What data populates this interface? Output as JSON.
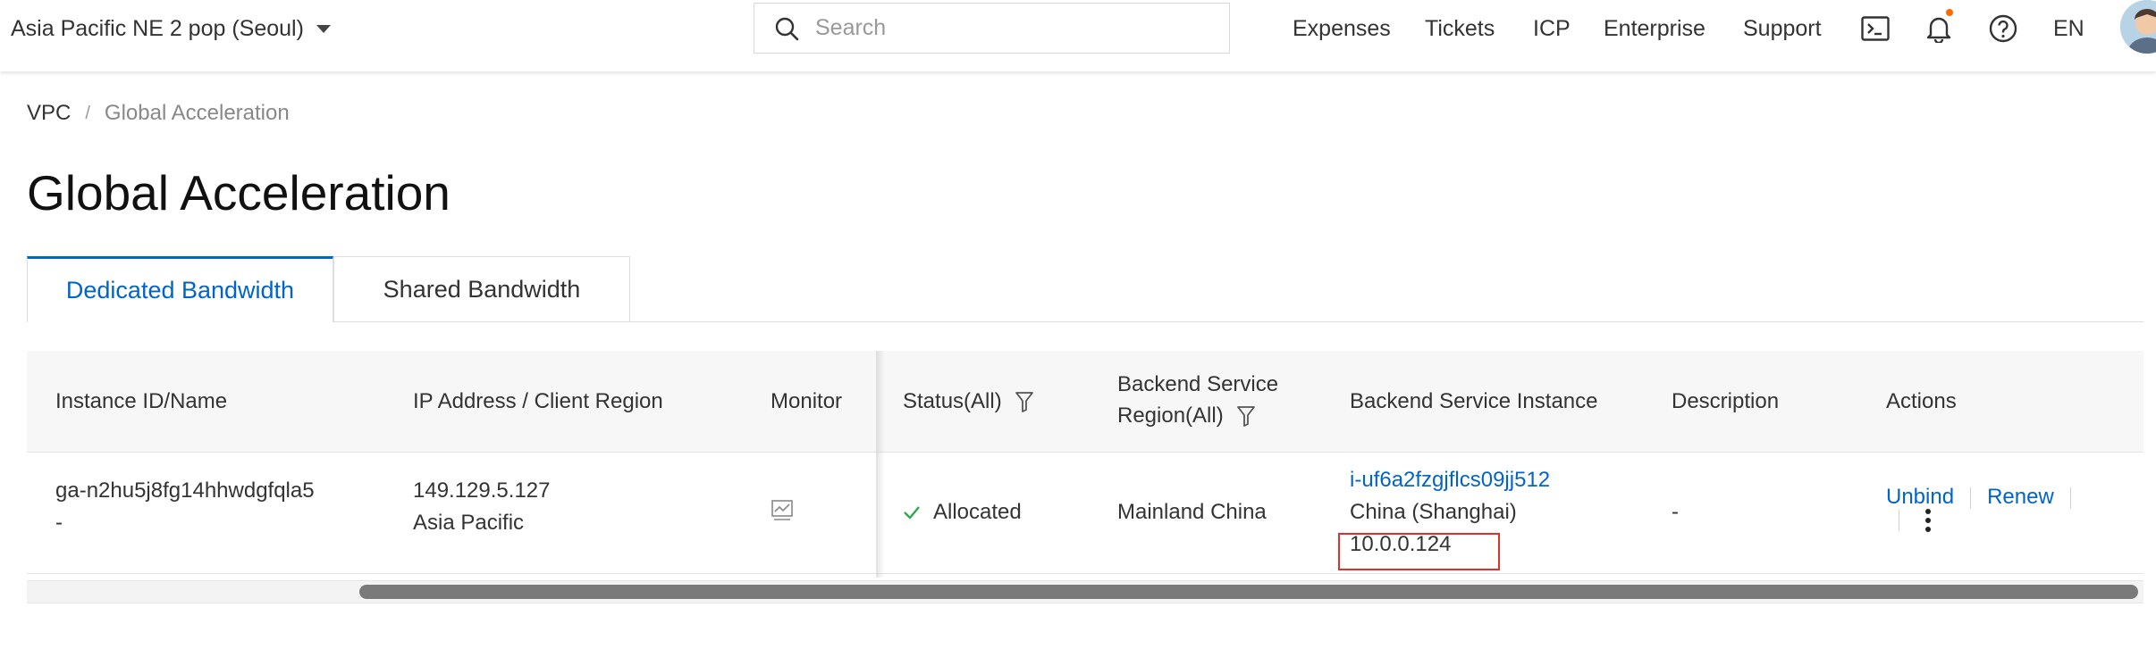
{
  "topbar": {
    "region": "Asia Pacific NE 2 pop (Seoul)",
    "search_placeholder": "Search",
    "nav": [
      "Expenses",
      "Tickets",
      "ICP",
      "Enterprise",
      "Support"
    ],
    "language": "EN",
    "icons": [
      "terminal-icon",
      "bell-icon",
      "help-icon"
    ],
    "notification_dot_color": "#ff6a00"
  },
  "breadcrumb": {
    "items": [
      "VPC",
      "Global Acceleration"
    ],
    "separator": "/"
  },
  "page": {
    "title": "Global Acceleration"
  },
  "tabs": [
    {
      "label": "Dedicated Bandwidth",
      "active": true
    },
    {
      "label": "Shared Bandwidth",
      "active": false
    }
  ],
  "table": {
    "columns": {
      "instance": "Instance ID/Name",
      "ip": "IP Address / Client Region",
      "monitor": "Monitor",
      "status": "Status(All)",
      "backend_region_line1": "Backend Service",
      "backend_region_line2": "Region(All)",
      "backend_instance": "Backend Service Instance",
      "description": "Description",
      "actions": "Actions"
    },
    "rows": [
      {
        "instance_id": "ga-n2hu5j8fg14hhwdgfqla5",
        "instance_name": "-",
        "ip": "149.129.5.127",
        "client_region": "Asia Pacific",
        "status": "Allocated",
        "backend_region": "Mainland China",
        "backend_instance_id": "i-uf6a2fzgjflcs09jj512",
        "backend_instance_region": "China (Shanghai)",
        "backend_instance_ip": "10.0.0.124",
        "description": "-",
        "actions": {
          "unbind": "Unbind",
          "renew": "Renew"
        }
      }
    ]
  },
  "colors": {
    "accent": "#0064c8",
    "highlight": "#e0302a",
    "status_ok": "#2fa84f"
  }
}
